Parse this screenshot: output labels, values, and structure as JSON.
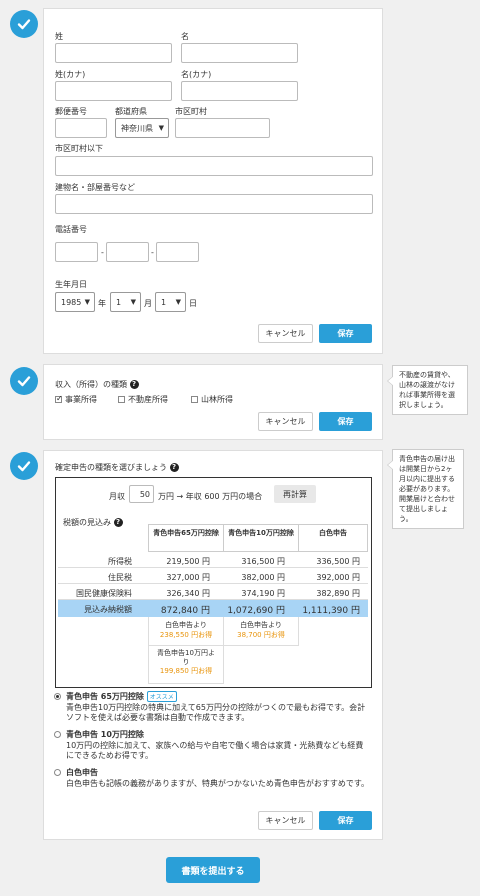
{
  "personal": {
    "sei_label": "姓",
    "mei_label": "名",
    "sei_kana_label": "姓(カナ)",
    "mei_kana_label": "名(カナ)",
    "postal_label": "郵便番号",
    "pref_label": "都道府県",
    "pref_value": "神奈川県",
    "city_label": "市区町村",
    "address_label": "市区町村以下",
    "building_label": "建物名・部屋番号など",
    "phone_label": "電話番号",
    "phone_sep": "-",
    "birthday_label": "生年月日",
    "year_value": "1985",
    "year_unit": "年",
    "month_value": "1",
    "month_unit": "月",
    "day_value": "1",
    "day_unit": "日",
    "cancel": "キャンセル",
    "save": "保存"
  },
  "income": {
    "title": "収入（所得）の種類",
    "options": [
      "事業所得",
      "不動産所得",
      "山林所得"
    ],
    "cancel": "キャンセル",
    "save": "保存",
    "tip": "不動産の賃貸や、山林の譲渡がなければ事業所得を選択しましょう。"
  },
  "filing": {
    "title": "確定申告の種類を選びましょう",
    "monthly_label": "月収",
    "monthly_value": "50",
    "calc_text": "万円 → 年収 600 万円の場合",
    "recalc": "再計算",
    "estimate_label": "税額の見込み",
    "col_headers": [
      "青色申告65万円控除",
      "青色申告10万円控除",
      "白色申告"
    ],
    "rows": [
      {
        "label": "所得税",
        "v": [
          "219,500 円",
          "316,500 円",
          "336,500 円"
        ]
      },
      {
        "label": "住民税",
        "v": [
          "327,000 円",
          "382,000 円",
          "392,000 円"
        ]
      },
      {
        "label": "国民健康保険料",
        "v": [
          "326,340 円",
          "374,190 円",
          "382,890 円"
        ]
      }
    ],
    "total": {
      "label": "見込み納税額",
      "v": [
        "872,840 円",
        "1,072,690 円",
        "1,111,390 円"
      ]
    },
    "saving1_a": "白色申告より",
    "saving1_b": "238,550 円お得",
    "saving2_a": "白色申告より",
    "saving2_b": "38,700 円お得",
    "saving3_a": "青色申告10万円より",
    "saving3_b": "199,850 円お得",
    "choices": [
      {
        "title": "青色申告 65万円控除",
        "badge": "オススメ",
        "desc": "青色申告10万円控除の特典に加えて65万円分の控除がつくので最もお得です。会計ソフトを使えば必要な書類は自動で作成できます。"
      },
      {
        "title": "青色申告 10万円控除",
        "desc": "10万円の控除に加えて、家族への給与や自宅で働く場合は家賃・光熱費なども経費にできるためお得です。"
      },
      {
        "title": "白色申告",
        "desc": "白色申告も記帳の義務がありますが、特典がつかないため青色申告がおすすめです。"
      }
    ],
    "cancel": "キャンセル",
    "save": "保存",
    "tip": "青色申告の届け出は開業日から2ヶ月以内に提出する必要があります。開業届けと合わせて提出しましょう。"
  },
  "submit": "書類を提出する",
  "colors": {
    "accent": "#2a9fd8",
    "orange": "#e8940c",
    "highlight": "#a8d4f5"
  }
}
